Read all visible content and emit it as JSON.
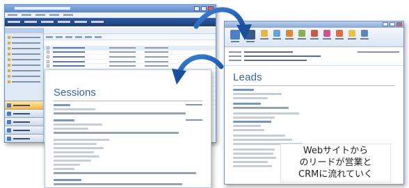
{
  "mail": {
    "heading": "Leads"
  },
  "sessions": {
    "heading": "Sessions"
  },
  "caption": {
    "line1": "Webサイトから",
    "line2": "のリードが営業と",
    "line3": "CRMに流れていく"
  },
  "colors": {
    "heading_blue": "#3a63a6",
    "arrow_blue": "#1f5fb0",
    "crm_nav_blue": "#1c3e78"
  },
  "icons": [
    "curved-arrow-icon",
    "curved-arrow-icon"
  ]
}
